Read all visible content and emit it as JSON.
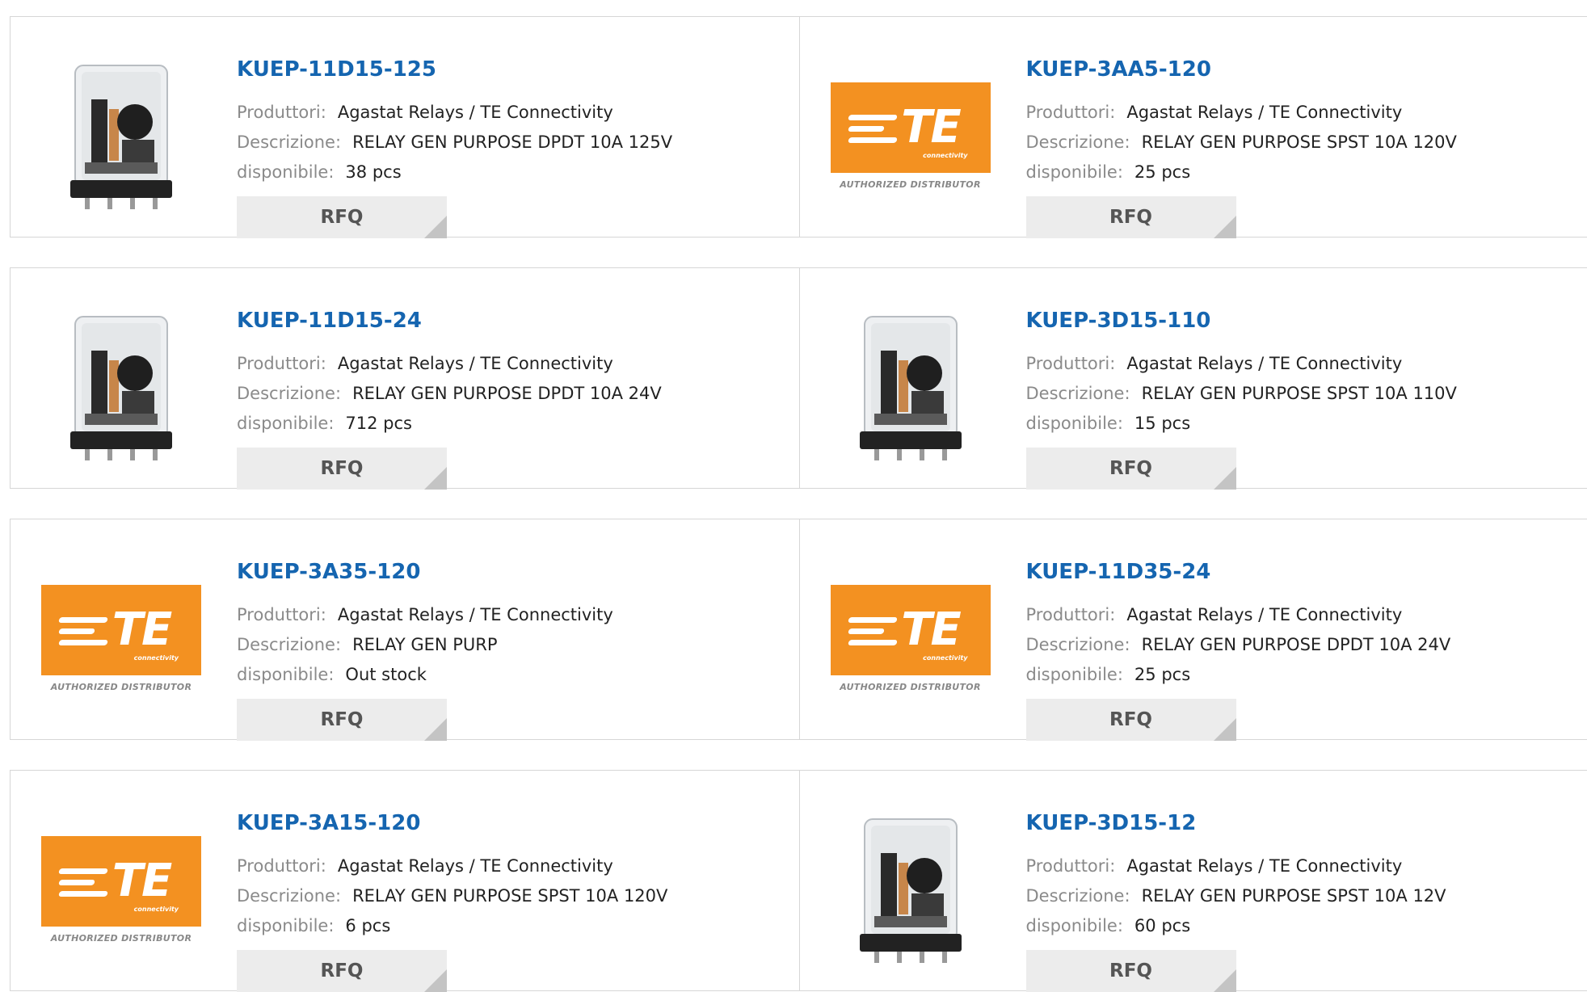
{
  "labels": {
    "manufacturer": "Produttori:",
    "description": "Descrizione:",
    "available": "disponibile:",
    "rfq": "RFQ",
    "logo_sub": "connectivity",
    "logo_auth": "AUTHORIZED DISTRIBUTOR",
    "logo_text": "TE"
  },
  "products": [
    {
      "pn": "KUEP-11D15-125",
      "mfr": "Agastat Relays / TE Connectivity",
      "desc": "RELAY GEN PURPOSE DPDT 10A 125V",
      "stock": "38 pcs",
      "image": "relay"
    },
    {
      "pn": "KUEP-3AA5-120",
      "mfr": "Agastat Relays / TE Connectivity",
      "desc": "RELAY GEN PURPOSE SPST 10A 120V",
      "stock": "25 pcs",
      "image": "te-logo"
    },
    {
      "pn": "KUEP-11D15-24",
      "mfr": "Agastat Relays / TE Connectivity",
      "desc": "RELAY GEN PURPOSE DPDT 10A 24V",
      "stock": "712 pcs",
      "image": "relay"
    },
    {
      "pn": "KUEP-3D15-110",
      "mfr": "Agastat Relays / TE Connectivity",
      "desc": "RELAY GEN PURPOSE SPST 10A 110V",
      "stock": "15 pcs",
      "image": "relay"
    },
    {
      "pn": "KUEP-3A35-120",
      "mfr": "Agastat Relays / TE Connectivity",
      "desc": "RELAY GEN PURP",
      "stock": "Out stock",
      "image": "te-logo"
    },
    {
      "pn": "KUEP-11D35-24",
      "mfr": "Agastat Relays / TE Connectivity",
      "desc": "RELAY GEN PURPOSE DPDT 10A 24V",
      "stock": "25 pcs",
      "image": "te-logo"
    },
    {
      "pn": "KUEP-3A15-120",
      "mfr": "Agastat Relays / TE Connectivity",
      "desc": "RELAY GEN PURPOSE SPST 10A 120V",
      "stock": "6 pcs",
      "image": "te-logo"
    },
    {
      "pn": "KUEP-3D15-12",
      "mfr": "Agastat Relays / TE Connectivity",
      "desc": "RELAY GEN PURPOSE SPST 10A 12V",
      "stock": "60 pcs",
      "image": "relay"
    }
  ]
}
